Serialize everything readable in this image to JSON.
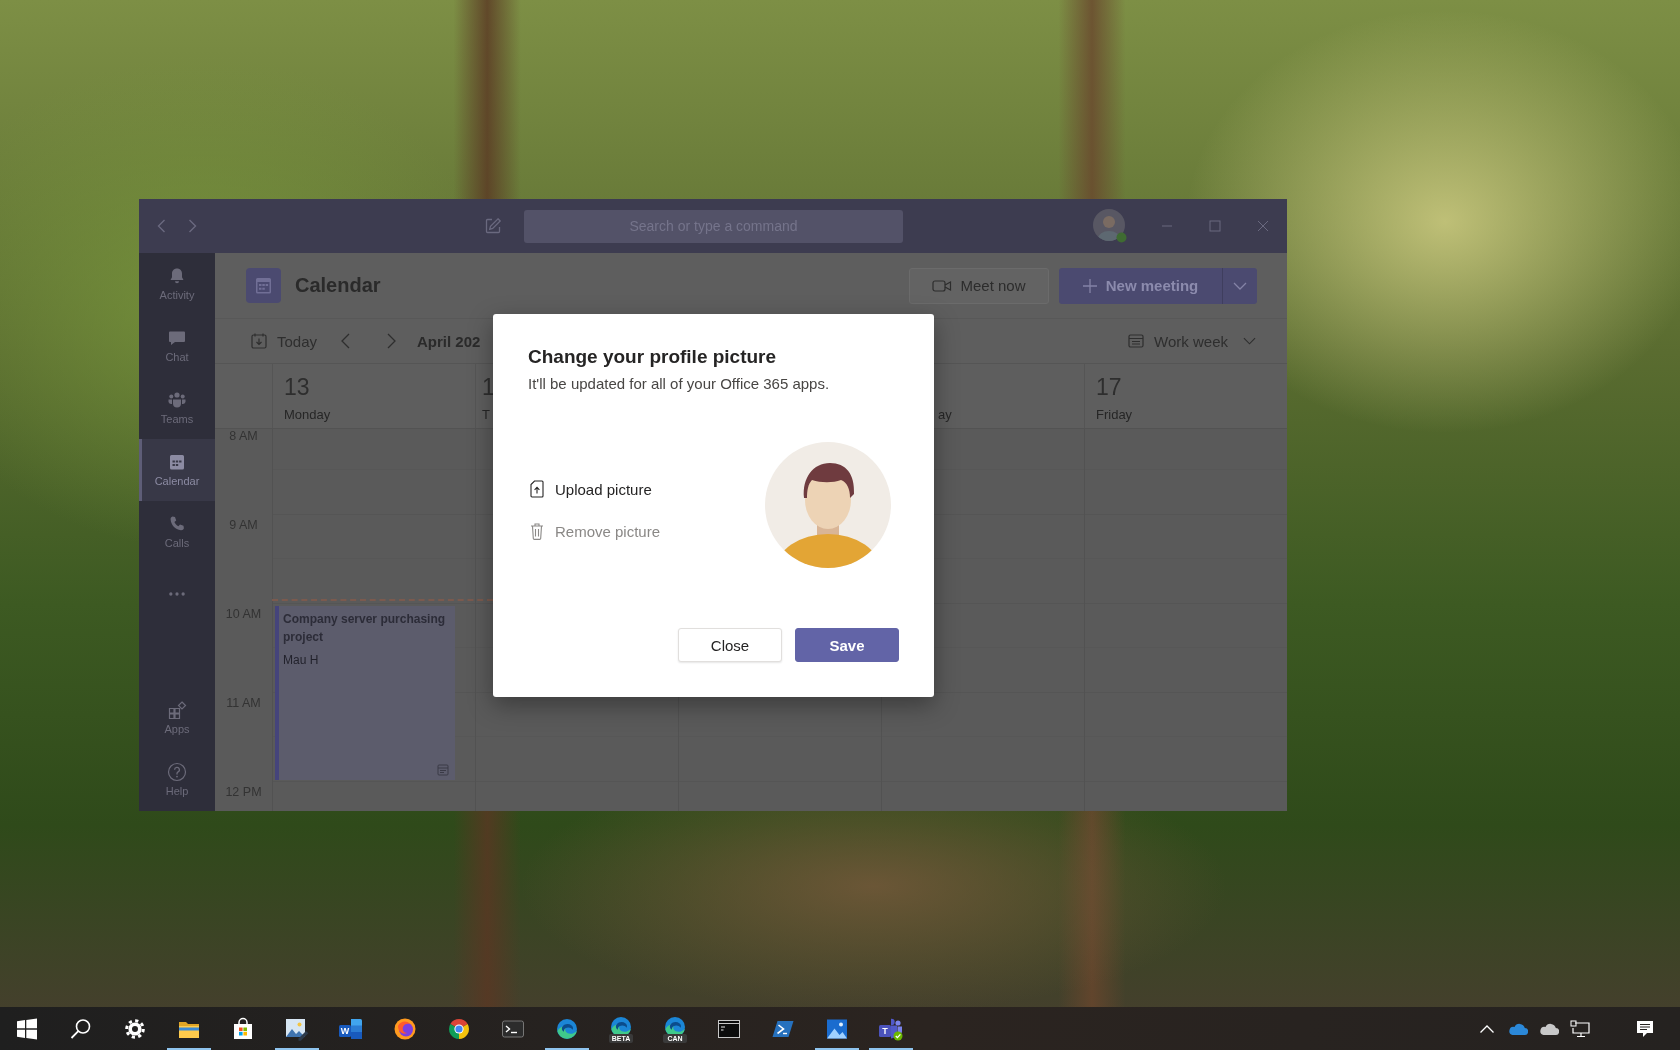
{
  "window": {
    "search": {
      "placeholder": "Search or type a command"
    },
    "rail": [
      {
        "kind": "activity",
        "label": "Activity",
        "selected": false
      },
      {
        "kind": "chat",
        "label": "Chat",
        "selected": false
      },
      {
        "kind": "teams",
        "label": "Teams",
        "selected": false
      },
      {
        "kind": "calendar",
        "label": "Calendar",
        "selected": true
      },
      {
        "kind": "calls",
        "label": "Calls",
        "selected": false
      },
      {
        "kind": "more",
        "selected": false
      }
    ],
    "rail_bottom": [
      {
        "kind": "apps",
        "label": "Apps",
        "selected": false
      },
      {
        "kind": "help",
        "label": "Help",
        "selected": false
      }
    ],
    "header": {
      "title": "Calendar",
      "meet_now": "Meet now",
      "new_meeting": "New meeting"
    },
    "toolbar": {
      "today": "Today",
      "month": "April 202",
      "view": "Work week"
    },
    "times": [
      "8 AM",
      "9 AM",
      "10 AM",
      "11 AM",
      "12 PM"
    ],
    "days": [
      {
        "number": "13",
        "name": "Monday",
        "events": [
          {
            "title": "Company server purchasing project",
            "organizer": "Mau H"
          }
        ]
      },
      {
        "number": "1",
        "name": "T"
      },
      {
        "name": "ay"
      },
      {
        "number": "17",
        "name": "Friday"
      }
    ]
  },
  "dialog": {
    "title": "Change your profile picture",
    "subtitle": "It'll be updated for all of your Office 365 apps.",
    "actions": [
      {
        "kind": "upload",
        "label": "Upload picture",
        "disabled": false
      },
      {
        "kind": "remove",
        "label": "Remove picture",
        "disabled": true
      }
    ],
    "buttons": [
      {
        "kind": "secondary",
        "label": "Close"
      },
      {
        "kind": "primary",
        "label": "Save"
      }
    ]
  },
  "taskbar": {
    "apps": [
      {
        "kind": "start",
        "running": false
      },
      {
        "kind": "search",
        "running": false
      },
      {
        "kind": "settings",
        "running": false
      },
      {
        "kind": "folder",
        "running": true
      },
      {
        "kind": "store",
        "running": false
      },
      {
        "kind": "photo-edit",
        "running": true
      },
      {
        "kind": "word",
        "letter": "W",
        "running": false
      },
      {
        "kind": "firefox",
        "running": false
      },
      {
        "kind": "chrome",
        "running": false
      },
      {
        "kind": "terminal",
        "running": false
      },
      {
        "kind": "edge",
        "running": true
      },
      {
        "kind": "edge",
        "badge": "BETA",
        "running": false
      },
      {
        "kind": "edge",
        "badge": "CAN",
        "running": false
      },
      {
        "kind": "console",
        "running": false
      },
      {
        "kind": "powershell",
        "running": false
      },
      {
        "kind": "photos",
        "running": true
      },
      {
        "kind": "teams",
        "letter": "T",
        "running": true
      }
    ],
    "tray": [
      {
        "kind": "chevron"
      },
      {
        "kind": "cloud",
        "color": "#2b88d8"
      },
      {
        "kind": "cloud",
        "color": "#c8c8c8"
      },
      {
        "kind": "network"
      },
      {
        "kind": "notifications"
      }
    ]
  }
}
